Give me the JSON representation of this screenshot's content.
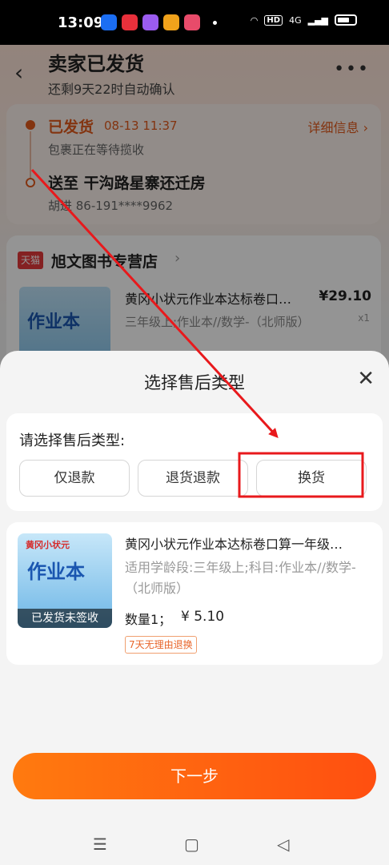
{
  "status_bar": {
    "time": "13:09",
    "net_badge": "HD",
    "signal_label": "4G",
    "app_icon_colors": [
      "#1b6ef3",
      "#e8303b",
      "#9b5cf0",
      "#f0a21b",
      "#e84b6a"
    ]
  },
  "background": {
    "header": {
      "back_icon": "chevron-left-icon",
      "title": "卖家已发货",
      "subtitle": "还剩9天22时自动确认",
      "more_icon": "more-dots-icon"
    },
    "logistics": {
      "status": "已发货",
      "time": "08-13 11:37",
      "detail_link": "详细信息 ›",
      "description": "包裹正在等待揽收",
      "address": "送至 干沟路星寨还迁房",
      "contact": "胡进 86-191****9962"
    },
    "shop": {
      "badge": "天猫",
      "name": "旭文图书专营店",
      "chevron": "›"
    },
    "product": {
      "cover_text": "作业本",
      "title": "黄冈小状元作业本达标卷口…",
      "spec": "三年级上;作业本//数学-（北师版）",
      "price": "¥29.10",
      "qty": "x1"
    }
  },
  "sheet": {
    "title": "选择售后类型",
    "close_icon": "close-icon",
    "type_prompt": "请选择售后类型:",
    "types": [
      "仅退款",
      "退货退款",
      "换货"
    ],
    "product": {
      "cover_text": "作业本",
      "cover_top": "黄冈小状元",
      "badge": "已发货未签收",
      "title": "黄冈小状元作业本达标卷口算一年级…",
      "spec": "适用学龄段:三年级上;科目:作业本//数学-（北师版）",
      "qty": "数量1；",
      "price": "¥ 5.10",
      "tag": "7天无理由退换"
    },
    "next_button": "下一步"
  },
  "nav_bar": {
    "menu_icon": "☰",
    "home_icon": "▢",
    "back_icon": "◁"
  },
  "annotation": {
    "color": "#e8191c"
  }
}
